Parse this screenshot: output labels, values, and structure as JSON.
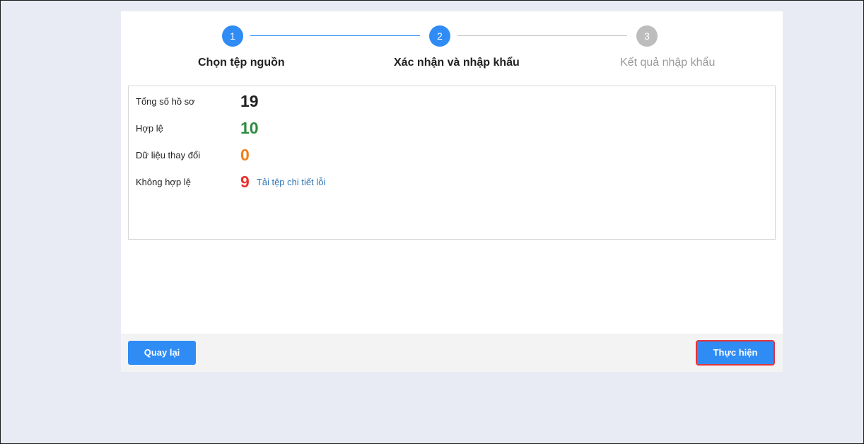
{
  "stepper": {
    "steps": [
      {
        "number": "1",
        "label": "Chọn tệp nguồn",
        "state": "completed"
      },
      {
        "number": "2",
        "label": "Xác nhận và nhập khẩu",
        "state": "active"
      },
      {
        "number": "3",
        "label": "Kết quả nhập khẩu",
        "state": "pending"
      }
    ]
  },
  "summary": {
    "total": {
      "label": "Tổng số hồ sơ",
      "value": "19"
    },
    "valid": {
      "label": "Hợp lệ",
      "value": "10"
    },
    "changed": {
      "label": "Dữ liệu thay đổi",
      "value": "0"
    },
    "invalid": {
      "label": "Không hợp lệ",
      "value": "9",
      "link": "Tải tệp chi tiết lỗi"
    }
  },
  "footer": {
    "back_label": "Quay lại",
    "submit_label": "Thực hiện"
  },
  "colors": {
    "accent": "#2f8cf5",
    "valid": "#2e8b3e",
    "changed": "#f08018",
    "invalid": "#e8312e",
    "total": "#222222",
    "step_inactive": "#bdbdbd",
    "highlight_border": "#e5333d"
  }
}
